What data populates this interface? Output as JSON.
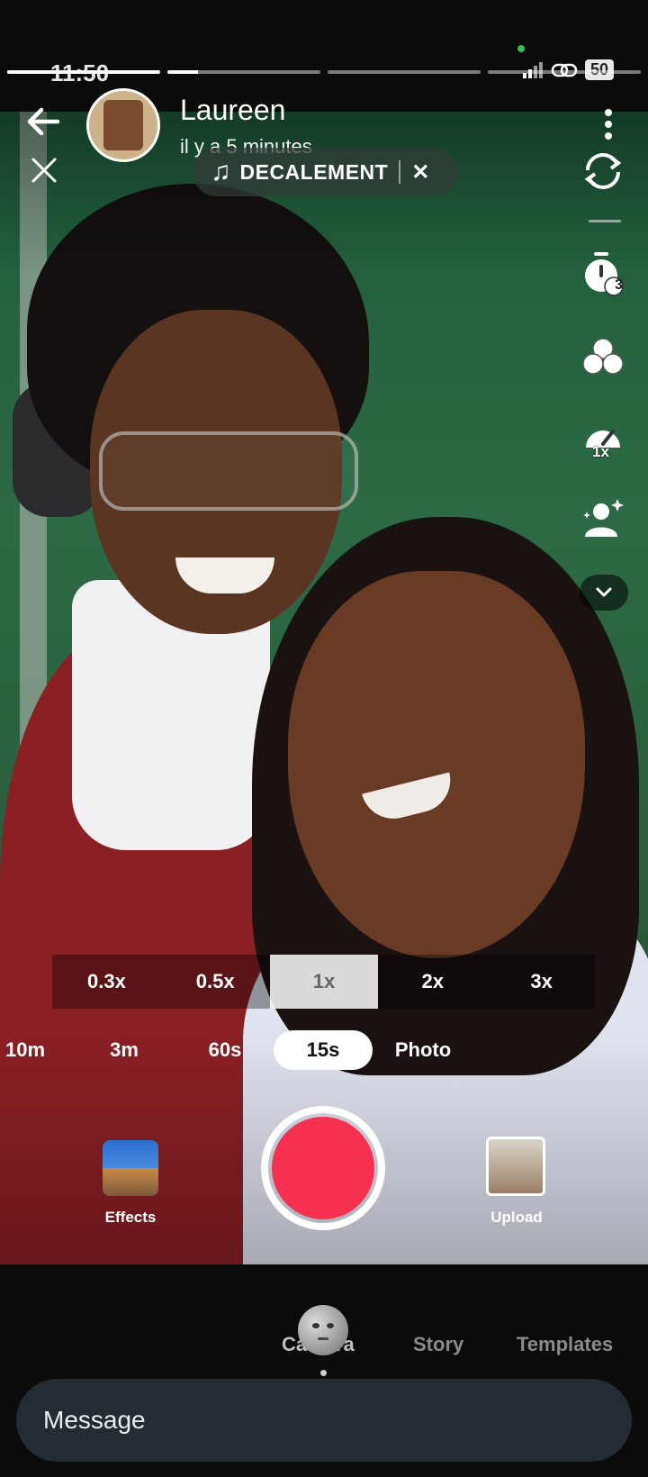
{
  "status": {
    "time": "11:50",
    "battery": "50"
  },
  "story": {
    "progress": [
      1.0,
      0.2,
      0.0,
      0.0
    ]
  },
  "header": {
    "username": "Laureen",
    "time_ago": "il y a 5 minutes"
  },
  "sound": {
    "label": "DECALEMENT"
  },
  "toolbar": {
    "timer_badge": "3",
    "speed_badge": "1x"
  },
  "zoom": {
    "levels": [
      "0.3x",
      "0.5x",
      "1x",
      "2x",
      "3x"
    ],
    "active": "1x"
  },
  "durations": {
    "options": [
      "10m",
      "3m",
      "60s",
      "15s",
      "Photo"
    ],
    "active": "15s"
  },
  "capture": {
    "effects_label": "Effects",
    "upload_label": "Upload",
    "record_color": "#f5314f"
  },
  "modes": {
    "items": [
      "Camera",
      "Story",
      "Templates"
    ],
    "active": "Camera"
  },
  "message": {
    "placeholder": "Message"
  }
}
